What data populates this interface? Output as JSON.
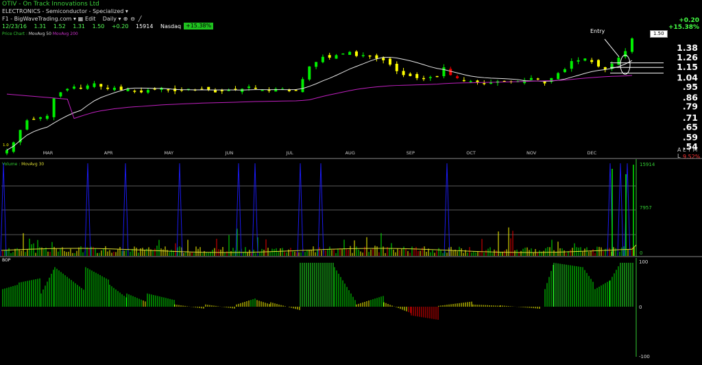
{
  "header": {
    "title": "OTIV - On Track Innovations Ltd",
    "sector": "ELECTRONICS - Semiconductor - Specialized",
    "layout_name": "F1 - BigWaveTrading.com",
    "edit_label": "Edit",
    "period_label": "Daily",
    "date": "12/23/16",
    "open": "1.31",
    "high": "1.52",
    "low": "1.31",
    "close": "1.50",
    "change": "+0.20",
    "volume": "15914",
    "exchange": "Nasdaq",
    "pct_change": "+15.38%"
  },
  "right_panel": {
    "change": "+0.20",
    "pct": "+15.38%",
    "last_price": "1.50",
    "aml": "A L T M L",
    "aml_sel": "L",
    "red_pct": "9.52%"
  },
  "legends": {
    "price": [
      "Price Chart : ",
      "MovAvg 50",
      "MovAvg 200"
    ],
    "volume": [
      "Volume : ",
      "MovAvg 30",
      ""
    ],
    "bop": "BOP"
  },
  "annotation": "Entry",
  "colors": {
    "up": "#00ee00",
    "down": "#ee0000",
    "neutral": "#ffff00",
    "ma50": "#e8e8e8",
    "ma200": "#c020c0",
    "volume_spike": "#1a1aee",
    "grid": "#5a5a5a"
  },
  "chart_data": [
    {
      "type": "candlestick",
      "title": "",
      "x_months": [
        "MAR",
        "APR",
        "MAY",
        "JUN",
        "JUL",
        "AUG",
        "SEP",
        "OCT",
        "NOV",
        "DEC"
      ],
      "y_ticks": [
        1.38,
        1.26,
        1.15,
        1.04,
        0.95,
        0.86,
        0.79,
        0.71,
        0.65,
        0.59,
        0.54
      ],
      "y_scale": "log",
      "y_range": [
        0.49,
        1.56
      ],
      "low_label": "1.0",
      "close_series": [
        0.52,
        0.56,
        0.63,
        0.69,
        0.7,
        0.71,
        0.72,
        0.85,
        0.9,
        0.93,
        0.95,
        0.94,
        0.96,
        0.98,
        0.95,
        0.93,
        0.94,
        0.92,
        0.93,
        0.91,
        0.9,
        0.92,
        0.93,
        0.94,
        0.92,
        0.91,
        0.92,
        0.93,
        0.92,
        0.93,
        0.92,
        0.9,
        0.91,
        0.92,
        0.92,
        0.93,
        0.95,
        0.93,
        0.92,
        0.92,
        0.93,
        0.93,
        0.91,
        0.92,
        1.02,
        1.15,
        1.2,
        1.26,
        1.25,
        1.28,
        1.3,
        1.32,
        1.27,
        1.28,
        1.27,
        1.24,
        1.22,
        1.17,
        1.1,
        1.06,
        1.05,
        1.03,
        1.03,
        1.04,
        1.05,
        1.14,
        1.06,
        1.03,
        1.01,
        1.0,
        0.99,
        0.98,
        0.99,
        1.0,
        1.0,
        0.99,
        1.0,
        1.01,
        1.03,
        1.02,
        0.98,
        1.03,
        1.08,
        1.12,
        1.21,
        1.22,
        1.24,
        1.2,
        1.15,
        1.12,
        1.18,
        1.25,
        1.33,
        1.5
      ],
      "series": [
        {
          "name": "MovAvg 50"
        },
        {
          "name": "MovAvg 200"
        }
      ],
      "entry_level": 1.26,
      "support_levels": [
        1.19,
        1.14,
        1.08
      ]
    },
    {
      "type": "bar",
      "title": "Volume",
      "y_ticks": [
        15914,
        7957,
        0
      ],
      "y_range": [
        0,
        15914
      ]
    },
    {
      "type": "bar",
      "title": "BOP",
      "y_ticks": [
        100,
        0,
        -100
      ],
      "y_range": [
        -100,
        100
      ]
    }
  ]
}
